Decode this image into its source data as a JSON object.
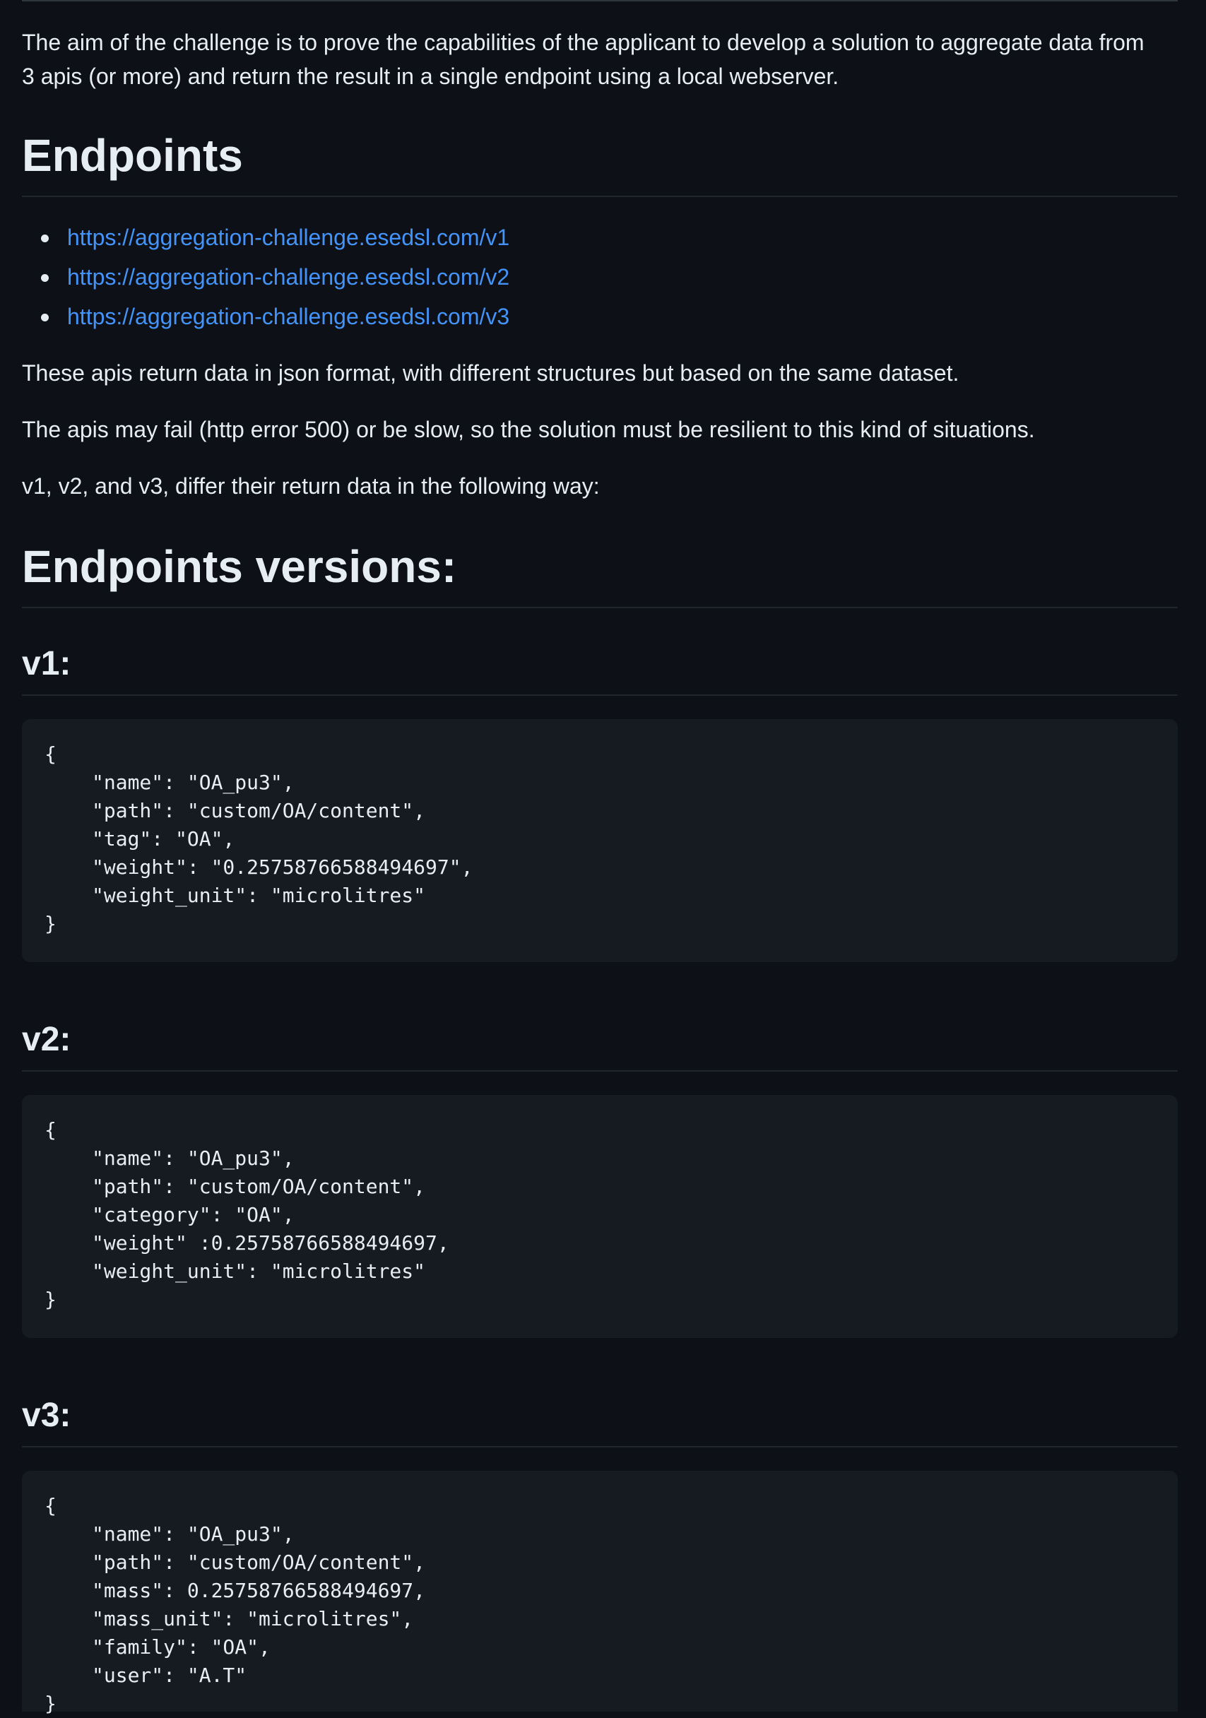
{
  "intro": {
    "line1": "The aim of the challenge is to prove the capabilities of the applicant to develop a solution to aggregate data from",
    "line2": "3 apis (or more) and return the result in a single endpoint using a local webserver."
  },
  "endpoints_heading": "Endpoints",
  "endpoints": [
    "https://aggregation-challenge.esedsl.com/v1",
    "https://aggregation-challenge.esedsl.com/v2",
    "https://aggregation-challenge.esedsl.com/v3"
  ],
  "paragraphs": {
    "p1": "These apis return data in json format, with different structures but based on the same dataset.",
    "p2": "The apis may fail (http error 500) or be slow, so the solution must be resilient to this kind of situations.",
    "p3": "v1, v2, and v3, differ their return data in the following way:"
  },
  "versions_heading": "Endpoints versions:",
  "versions": [
    {
      "heading": "v1:",
      "code": [
        "{",
        "\"name\": \"OA_pu3\",",
        "\"path\": \"custom/OA/content\",",
        "\"tag\": \"OA\",",
        "\"weight\": \"0.25758766588494697\",",
        "\"weight_unit\": \"microlitres\"",
        "}"
      ]
    },
    {
      "heading": "v2:",
      "code": [
        "{",
        "\"name\": \"OA_pu3\",",
        "\"path\": \"custom/OA/content\",",
        "\"category\": \"OA\",",
        "\"weight\" :0.25758766588494697,",
        "\"weight_unit\": \"microlitres\"",
        "}"
      ]
    },
    {
      "heading": "v3:",
      "code": [
        "{",
        "\"name\": \"OA_pu3\",",
        "\"path\": \"custom/OA/content\",",
        "\"mass\": 0.25758766588494697,",
        "\"mass_unit\": \"microlitres\",",
        "\"family\": \"OA\",",
        "\"user\": \"A.T\"",
        "}"
      ]
    }
  ]
}
